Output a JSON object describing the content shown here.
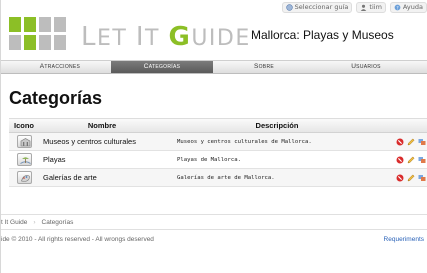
{
  "topbar": {
    "select_guide": "Seleccionar guía",
    "user": "tiim",
    "help": "Ayuda"
  },
  "header": {
    "brand_l": "L",
    "brand_et": "ET",
    "brand_i": "I",
    "brand_t": "T",
    "brand_g": "G",
    "brand_uide": "UIDE",
    "subtitle": "Mallorca: Playas y Museos"
  },
  "nav": {
    "tabs": [
      {
        "label": "Atracciones"
      },
      {
        "label": "Categorías"
      },
      {
        "label": "Sobre"
      },
      {
        "label": "Usuarios"
      }
    ]
  },
  "page": {
    "title": "Categorías"
  },
  "table": {
    "headers": {
      "icon": "Icono",
      "name": "Nombre",
      "description": "Descripción"
    },
    "rows": [
      {
        "name": "Museos y centros culturales",
        "description": "Museos y centros culturales de Mallorca.",
        "icon": "museum-icon"
      },
      {
        "name": "Playas",
        "description": "Playas de Mallorca.",
        "icon": "beach-icon"
      },
      {
        "name": "Galerías de arte",
        "description": "Galerías de arte de Mallorca.",
        "icon": "art-gallery-icon"
      }
    ]
  },
  "breadcrumb": {
    "items": [
      "t It Guide",
      "Categorías"
    ]
  },
  "footer": {
    "copyright": "ide © 2010 - All rights reserved - All wrongs deserved",
    "requirements": "Requeriments"
  },
  "colors": {
    "brand_green": "#8cbf26",
    "logo_grey": "#b9b9b9",
    "nav_active": "#666666",
    "link_blue": "#2a62b8"
  }
}
